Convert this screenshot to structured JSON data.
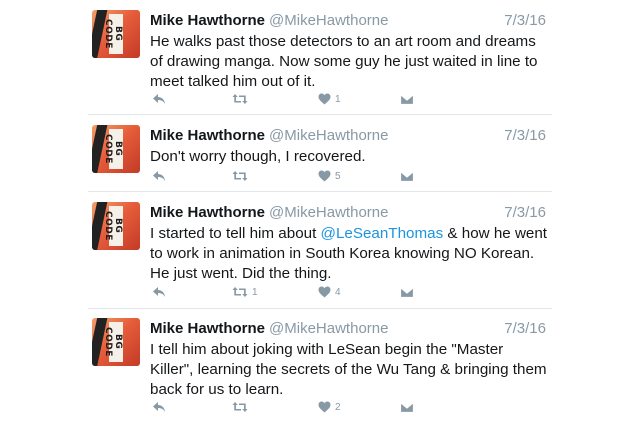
{
  "colors": {
    "text": "#14171a",
    "muted": "#8899a6",
    "mention": "#1b95e0",
    "divider": "#e1e8ed"
  },
  "avatar": {
    "text": "BG CODE"
  },
  "tweets": [
    {
      "name": "Mike Hawthorne",
      "handle": "@MikeHawthorne",
      "date": "7/3/16",
      "lines": [
        "He walks past those detectors to an art room and dreams",
        "of drawing manga. Now some guy he just waited in line to",
        "meet talked him out of it."
      ],
      "retweets": "",
      "likes": "1",
      "icons": [
        "reply-icon",
        "retweet-icon",
        "heart-icon",
        "envelope-icon"
      ]
    },
    {
      "name": "Mike Hawthorne",
      "handle": "@MikeHawthorne",
      "date": "7/3/16",
      "lines": [
        "Don't worry though, I recovered."
      ],
      "retweets": "",
      "likes": "5",
      "icons": [
        "reply-icon",
        "retweet-icon",
        "heart-icon",
        "envelope-icon"
      ]
    },
    {
      "name": "Mike Hawthorne",
      "handle": "@MikeHawthorne",
      "date": "7/3/16",
      "line1_pre": "I started to tell him about ",
      "line1_mention": "@LeSeanThomas",
      "line1_post": " & how he went",
      "lines": [
        "to work in animation in South Korea knowing NO Korean.",
        "He just went. Did the thing."
      ],
      "retweets": "1",
      "likes": "4",
      "icons": [
        "reply-icon",
        "retweet-icon",
        "heart-icon",
        "envelope-icon"
      ]
    },
    {
      "name": "Mike Hawthorne",
      "handle": "@MikeHawthorne",
      "date": "7/3/16",
      "lines": [
        "I tell him about joking with LeSean begin the \"Master",
        "Killer\", learning the secrets of the Wu Tang & bringing them",
        "back for us to learn."
      ],
      "retweets": "",
      "likes": "2",
      "icons": [
        "reply-icon",
        "retweet-icon",
        "heart-icon",
        "envelope-icon"
      ]
    }
  ]
}
